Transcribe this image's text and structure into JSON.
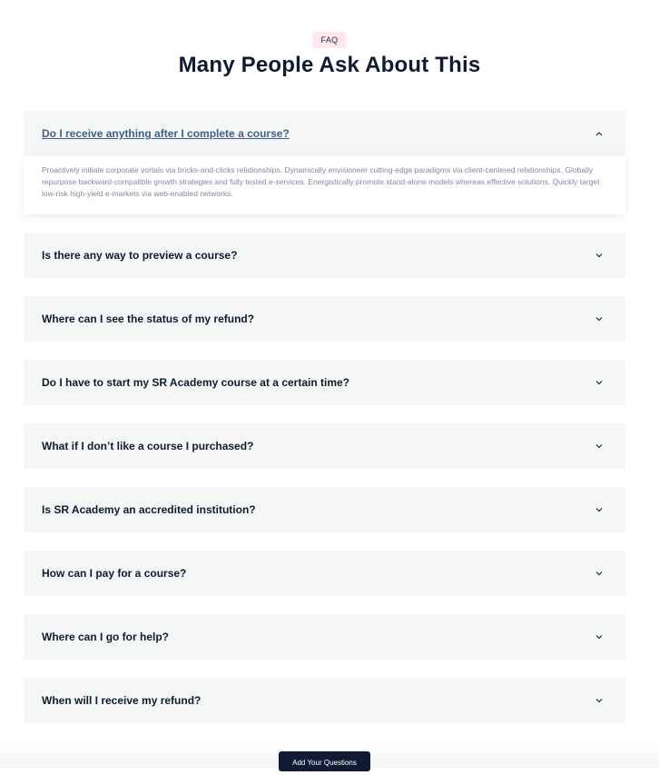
{
  "header": {
    "badge": "FAQ",
    "title": "Many People Ask About This"
  },
  "faq": {
    "open_item": {
      "question": "Do I receive anything after I complete a course?",
      "answer": "Proactively initiate corporate vortals via bricks-and-clicks relationships. Dynamically envisioneer cutting-edge paradigms via client-centered relationships. Globally repurpose backward-compatible growth strategies and fully tested e-services. Energistically promote stand-alone models whereas effective solutions. Quickly target low-risk high-yield e-markets via web-enabled networks."
    },
    "items": [
      {
        "question": "Is there any way to preview a course?"
      },
      {
        "question": "Where can I see the status of my refund?"
      },
      {
        "question": "Do I have to start my SR Academy course at a certain time?"
      },
      {
        "question": "What if I don’t like a course I purchased?"
      },
      {
        "question": "Is SR Academy an accredited institution?"
      },
      {
        "question": "How can I pay for a course?"
      },
      {
        "question": "Where can I go for help?"
      },
      {
        "question": "When will I receive my refund?"
      }
    ]
  },
  "cta": {
    "label": "Add Your Questions"
  },
  "icons": {
    "expanded": "chevron-up-icon",
    "collapsed": "chevron-down-icon"
  },
  "colors": {
    "navy": "#0f1b33",
    "link": "#3d5f8f",
    "answer_text": "#7e8aa6",
    "badge_bg": "#fde9ea",
    "item_bg": "#f5f7f7"
  }
}
